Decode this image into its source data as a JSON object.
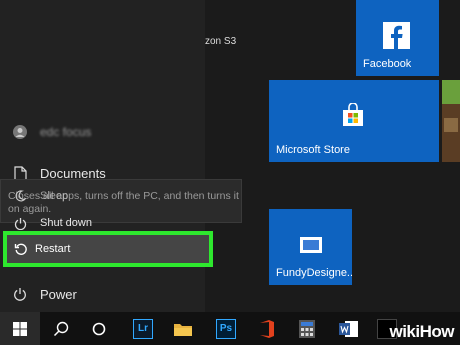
{
  "bg_text": "zon S3",
  "user": {
    "name": "edc focus"
  },
  "menu": {
    "documents": "Documents",
    "sleep": "Sleep",
    "shutdown": "Shut down",
    "restart": "Restart",
    "power": "Power"
  },
  "tooltip": "Closes all apps, turns off the PC, and then turns it on again.",
  "tiles": {
    "facebook": "Facebook",
    "store": "Microsoft Store",
    "fundy": "FundyDesigne..."
  },
  "taskbar": {
    "lightroom": "Lr",
    "photoshop": "Ps"
  },
  "watermark": {
    "wiki": "wiki",
    "how": "How"
  },
  "colors": {
    "accent": "#0e63c0",
    "highlight": "#2ee82e"
  }
}
